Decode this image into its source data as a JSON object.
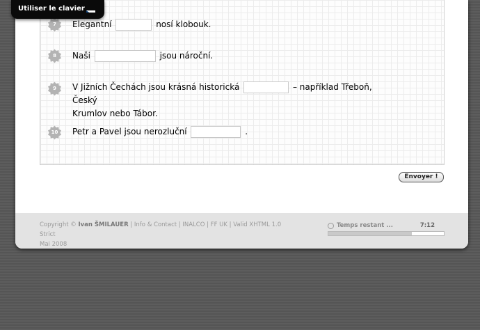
{
  "keyboard_toggle": {
    "label": "Utiliser le clavier",
    "flag_icon": "czech-flag-icon"
  },
  "questions": [
    {
      "number": "7",
      "before": "Elegantní",
      "after": "nosí klobouk."
    },
    {
      "number": "8",
      "before": "Naši",
      "after": "jsou nároční."
    },
    {
      "number": "9",
      "before": "V Jižních Čechách jsou krásná historická",
      "after": "– například Třeboň, Český",
      "after2": "Krumlov nebo Tábor."
    },
    {
      "number": "10",
      "before": "Petr a Pavel jsou nerozluční",
      "after": "."
    }
  ],
  "submit_label": "Envoyer !",
  "footer": {
    "copyright_prefix": "Copyright ©",
    "author": "Ivan ŠMILAUER",
    "links_text": "| Info & Contact | INALCO | FF UK | Valid XHTML 1.0 Strict",
    "date": "Mai 2008"
  },
  "timer": {
    "label": "Temps restant ...",
    "value": "7:12",
    "progress_remaining": 0.72
  },
  "colors": {
    "badge": "#b3b3b3",
    "background": "#595959",
    "footer": "#e3e3e3"
  }
}
